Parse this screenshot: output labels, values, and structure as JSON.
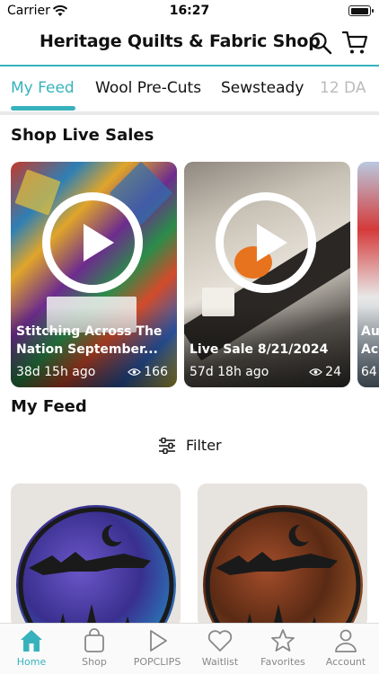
{
  "status_bar": {
    "carrier": "Carrier",
    "time": "16:27"
  },
  "header": {
    "title": "Heritage Quilts & Fabric Shop",
    "icons": [
      "search-icon",
      "cart-icon"
    ]
  },
  "tabs": [
    {
      "label": "My Feed",
      "active": true
    },
    {
      "label": "Wool Pre-Cuts",
      "active": false
    },
    {
      "label": "Sewsteady",
      "active": false
    },
    {
      "label": "12 DA",
      "active": false
    }
  ],
  "live_sales": {
    "heading": "Shop Live Sales",
    "cards": [
      {
        "title": "Stitching Across The Nation September...",
        "time_ago": "38d 15h ago",
        "views": "166"
      },
      {
        "title": "Live Sale 8/21/2024",
        "time_ago": "57d 18h ago",
        "views": "24"
      },
      {
        "title": "Au Ac",
        "time_ago": "64",
        "views": ""
      }
    ]
  },
  "feed": {
    "heading": "My Feed",
    "filter_label": "Filter"
  },
  "bottom_nav": [
    {
      "label": "Home",
      "icon": "home-icon",
      "active": true
    },
    {
      "label": "Shop",
      "icon": "bag-icon",
      "active": false
    },
    {
      "label": "POPCLIPS",
      "icon": "play-icon",
      "active": false
    },
    {
      "label": "Waitlist",
      "icon": "heart-icon",
      "active": false
    },
    {
      "label": "Favorites",
      "icon": "star-icon",
      "active": false
    },
    {
      "label": "Account",
      "icon": "person-icon",
      "active": false
    }
  ],
  "colors": {
    "accent": "#37b2bd",
    "text": "#111111",
    "muted": "#888888"
  }
}
